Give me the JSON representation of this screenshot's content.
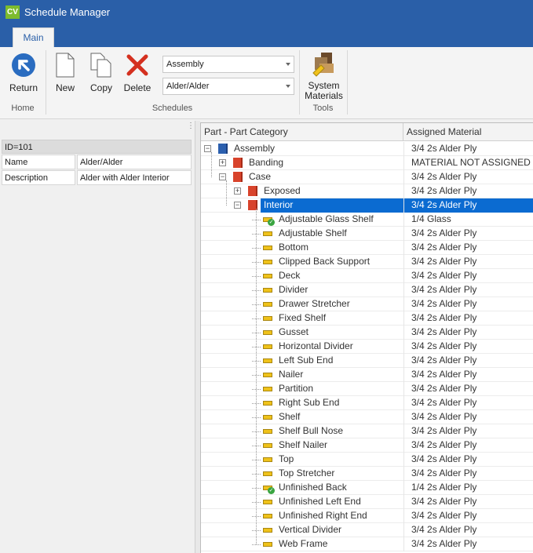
{
  "app": {
    "logo": "CV",
    "title": "Schedule Manager"
  },
  "ribbon": {
    "tab_main": "Main",
    "return_label": "Return",
    "new_label": "New",
    "copy_label": "Copy",
    "delete_label": "Delete",
    "assembly_combo_value": "Assembly",
    "material_combo_value": "Alder/Alder",
    "system_materials_label_1": "System",
    "system_materials_label_2": "Materials",
    "group_home": "Home",
    "group_schedules": "Schedules",
    "group_tools": "Tools"
  },
  "props": {
    "id": "ID=101",
    "rows": [
      {
        "key": "Name",
        "value": "Alder/Alder"
      },
      {
        "key": "Description",
        "value": "Alder with Alder Interior"
      }
    ]
  },
  "grid": {
    "col_part": "Part - Part Category",
    "col_material": "Assigned Material",
    "rows": [
      {
        "name": "Assembly",
        "material": "3/4 2s Alder Ply",
        "kind": "category-blue",
        "expander": "minus",
        "level": 0
      },
      {
        "name": "Banding",
        "material": "MATERIAL NOT ASSIGNED",
        "kind": "category",
        "expander": "plus",
        "level": 1
      },
      {
        "name": "Case",
        "material": "3/4 2s Alder Ply",
        "kind": "category",
        "expander": "minus",
        "level": 1
      },
      {
        "name": "Exposed",
        "material": "3/4 2s Alder Ply",
        "kind": "category",
        "expander": "plus",
        "level": 2
      },
      {
        "name": "Interior",
        "material": "3/4 2s Alder Ply",
        "kind": "category",
        "expander": "minus",
        "level": 2,
        "selected": true
      },
      {
        "name": "Adjustable Glass Shelf",
        "material": "1/4 Glass",
        "kind": "part-check",
        "level": 3
      },
      {
        "name": "Adjustable Shelf",
        "material": "3/4 2s Alder Ply",
        "kind": "part",
        "level": 3
      },
      {
        "name": "Bottom",
        "material": "3/4 2s Alder Ply",
        "kind": "part",
        "level": 3
      },
      {
        "name": "Clipped Back Support",
        "material": "3/4 2s Alder Ply",
        "kind": "part",
        "level": 3
      },
      {
        "name": "Deck",
        "material": "3/4 2s Alder Ply",
        "kind": "part",
        "level": 3
      },
      {
        "name": "Divider",
        "material": "3/4 2s Alder Ply",
        "kind": "part",
        "level": 3
      },
      {
        "name": "Drawer Stretcher",
        "material": "3/4 2s Alder Ply",
        "kind": "part",
        "level": 3
      },
      {
        "name": "Fixed Shelf",
        "material": "3/4 2s Alder Ply",
        "kind": "part",
        "level": 3
      },
      {
        "name": "Gusset",
        "material": "3/4 2s Alder Ply",
        "kind": "part",
        "level": 3
      },
      {
        "name": "Horizontal Divider",
        "material": "3/4 2s Alder Ply",
        "kind": "part",
        "level": 3
      },
      {
        "name": "Left Sub End",
        "material": "3/4 2s Alder Ply",
        "kind": "part",
        "level": 3
      },
      {
        "name": "Nailer",
        "material": "3/4 2s Alder Ply",
        "kind": "part",
        "level": 3
      },
      {
        "name": "Partition",
        "material": "3/4 2s Alder Ply",
        "kind": "part",
        "level": 3
      },
      {
        "name": "Right Sub End",
        "material": "3/4 2s Alder Ply",
        "kind": "part",
        "level": 3
      },
      {
        "name": "Shelf",
        "material": "3/4 2s Alder Ply",
        "kind": "part",
        "level": 3
      },
      {
        "name": "Shelf Bull Nose",
        "material": "3/4 2s Alder Ply",
        "kind": "part",
        "level": 3
      },
      {
        "name": "Shelf Nailer",
        "material": "3/4 2s Alder Ply",
        "kind": "part",
        "level": 3
      },
      {
        "name": "Top",
        "material": "3/4 2s Alder Ply",
        "kind": "part",
        "level": 3
      },
      {
        "name": "Top Stretcher",
        "material": "3/4 2s Alder Ply",
        "kind": "part",
        "level": 3
      },
      {
        "name": "Unfinished Back",
        "material": "1/4 2s Alder Ply",
        "kind": "part-check",
        "level": 3
      },
      {
        "name": "Unfinished Left End",
        "material": "3/4 2s Alder Ply",
        "kind": "part",
        "level": 3
      },
      {
        "name": "Unfinished Right End",
        "material": "3/4 2s Alder Ply",
        "kind": "part",
        "level": 3
      },
      {
        "name": "Vertical Divider",
        "material": "3/4 2s Alder Ply",
        "kind": "part",
        "level": 3
      },
      {
        "name": "Web Frame",
        "material": "3/4 2s Alder Ply",
        "kind": "part",
        "level": 3
      }
    ]
  },
  "colors": {
    "titlebar": "#2a5fa8",
    "selection": "#0b6bd1",
    "category": "#d8432b",
    "part": "#efc21a",
    "check": "#3aa541"
  }
}
